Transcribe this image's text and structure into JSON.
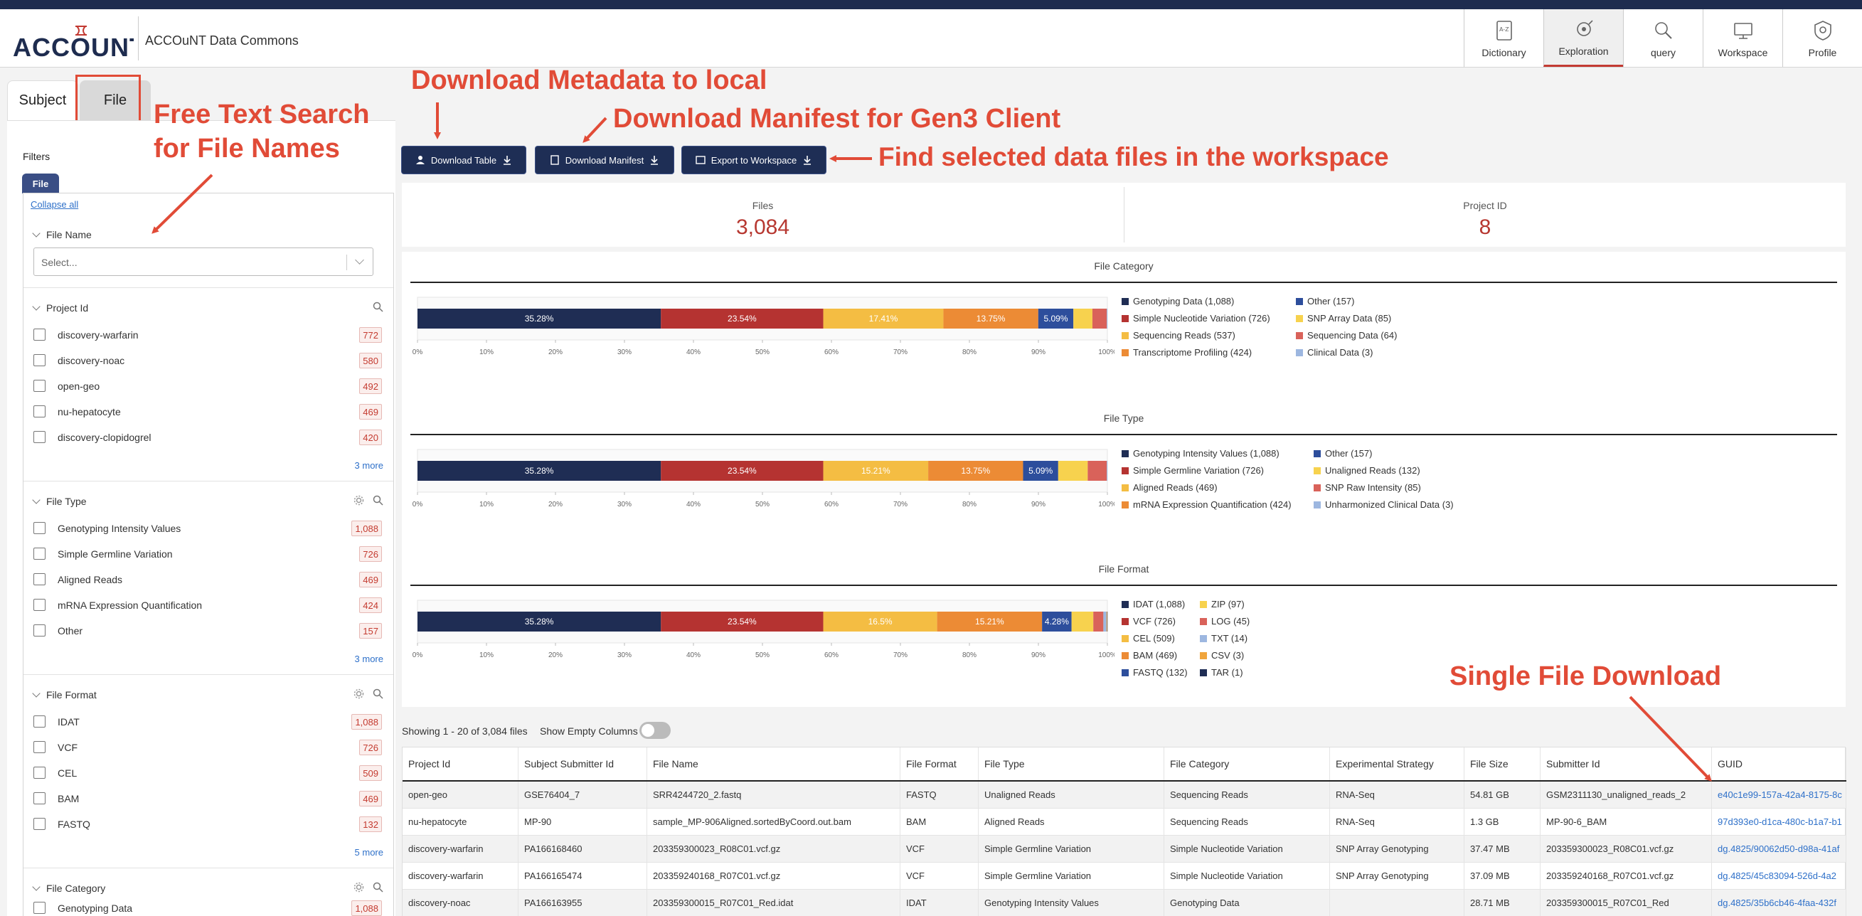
{
  "header": {
    "logo_text": "ACCOUNT",
    "commons_name": "ACCOuNT Data Commons",
    "nav": [
      {
        "label": "Dictionary",
        "icon": "dictionary-icon"
      },
      {
        "label": "Exploration",
        "icon": "exploration-icon",
        "active": true
      },
      {
        "label": "query",
        "icon": "query-icon"
      },
      {
        "label": "Workspace",
        "icon": "workspace-icon"
      },
      {
        "label": "Profile",
        "icon": "profile-icon"
      }
    ]
  },
  "tabs": {
    "subject": "Subject",
    "file": "File"
  },
  "filters": {
    "title": "Filters",
    "chip": "File",
    "collapse_all": "Collapse all",
    "file_name": {
      "title": "File Name",
      "placeholder": "Select..."
    },
    "project_id": {
      "title": "Project Id",
      "options": [
        {
          "label": "discovery-warfarin",
          "count": "772"
        },
        {
          "label": "discovery-noac",
          "count": "580"
        },
        {
          "label": "open-geo",
          "count": "492"
        },
        {
          "label": "nu-hepatocyte",
          "count": "469"
        },
        {
          "label": "discovery-clopidogrel",
          "count": "420"
        }
      ],
      "more": "3 more"
    },
    "file_type": {
      "title": "File Type",
      "options": [
        {
          "label": "Genotyping Intensity Values",
          "count": "1,088"
        },
        {
          "label": "Simple Germline Variation",
          "count": "726"
        },
        {
          "label": "Aligned Reads",
          "count": "469"
        },
        {
          "label": "mRNA Expression Quantification",
          "count": "424"
        },
        {
          "label": "Other",
          "count": "157"
        }
      ],
      "more": "3 more"
    },
    "file_format": {
      "title": "File Format",
      "options": [
        {
          "label": "IDAT",
          "count": "1,088"
        },
        {
          "label": "VCF",
          "count": "726"
        },
        {
          "label": "CEL",
          "count": "509"
        },
        {
          "label": "BAM",
          "count": "469"
        },
        {
          "label": "FASTQ",
          "count": "132"
        }
      ],
      "more": "5 more"
    },
    "file_category": {
      "title": "File Category",
      "options": [
        {
          "label": "Genotyping Data",
          "count": "1,088"
        }
      ]
    }
  },
  "buttons": {
    "download_table": "Download Table",
    "download_manifest": "Download Manifest",
    "export_workspace": "Export to Workspace"
  },
  "stats": {
    "files_label": "Files",
    "files_value": "3,084",
    "project_label": "Project ID",
    "project_value": "8"
  },
  "chart_data": [
    {
      "type": "bar",
      "orientation": "horizontal-stacked",
      "title": "File Category",
      "xlim": [
        0,
        100
      ],
      "ticks": [
        "0%",
        "10%",
        "20%",
        "30%",
        "40%",
        "50%",
        "60%",
        "70%",
        "80%",
        "90%",
        "100%"
      ],
      "series": [
        {
          "name": "Genotyping Data",
          "count": "1,088",
          "percent": 35.28,
          "label": "35.28%",
          "color": "#1f2d54"
        },
        {
          "name": "Simple Nucleotide Variation",
          "count": "726",
          "percent": 23.54,
          "label": "23.54%",
          "color": "#b53331"
        },
        {
          "name": "Sequencing Reads",
          "count": "537",
          "percent": 17.41,
          "label": "17.41%",
          "color": "#f4bd43"
        },
        {
          "name": "Transcriptome Profiling",
          "count": "424",
          "percent": 13.75,
          "label": "13.75%",
          "color": "#ec8b35"
        },
        {
          "name": "Other",
          "count": "157",
          "percent": 5.09,
          "label": "5.09%",
          "color": "#2d4e9c"
        },
        {
          "name": "SNP Array Data",
          "count": "85",
          "percent": 2.76,
          "label": "",
          "color": "#f7d24e"
        },
        {
          "name": "Sequencing Data",
          "count": "64",
          "percent": 2.08,
          "label": "",
          "color": "#d9625a"
        },
        {
          "name": "Clinical Data",
          "count": "3",
          "percent": 0.1,
          "label": "",
          "color": "#9db7e0"
        }
      ]
    },
    {
      "type": "bar",
      "orientation": "horizontal-stacked",
      "title": "File Type",
      "xlim": [
        0,
        100
      ],
      "ticks": [
        "0%",
        "10%",
        "20%",
        "30%",
        "40%",
        "50%",
        "60%",
        "70%",
        "80%",
        "90%",
        "100%"
      ],
      "series": [
        {
          "name": "Genotyping Intensity Values",
          "count": "1,088",
          "percent": 35.28,
          "label": "35.28%",
          "color": "#1f2d54"
        },
        {
          "name": "Simple Germline Variation",
          "count": "726",
          "percent": 23.54,
          "label": "23.54%",
          "color": "#b53331"
        },
        {
          "name": "Aligned Reads",
          "count": "469",
          "percent": 15.21,
          "label": "15.21%",
          "color": "#f4bd43"
        },
        {
          "name": "mRNA Expression Quantification",
          "count": "424",
          "percent": 13.75,
          "label": "13.75%",
          "color": "#ec8b35"
        },
        {
          "name": "Other",
          "count": "157",
          "percent": 5.09,
          "label": "5.09%",
          "color": "#2d4e9c"
        },
        {
          "name": "Unaligned Reads",
          "count": "132",
          "percent": 4.28,
          "label": "",
          "color": "#f7d24e"
        },
        {
          "name": "SNP Raw Intensity",
          "count": "85",
          "percent": 2.76,
          "label": "",
          "color": "#d9625a"
        },
        {
          "name": "Unharmonized Clinical Data",
          "count": "3",
          "percent": 0.1,
          "label": "",
          "color": "#9db7e0"
        }
      ]
    },
    {
      "type": "bar",
      "orientation": "horizontal-stacked",
      "title": "File Format",
      "xlim": [
        0,
        100
      ],
      "ticks": [
        "0%",
        "10%",
        "20%",
        "30%",
        "40%",
        "50%",
        "60%",
        "70%",
        "80%",
        "90%",
        "100%"
      ],
      "series": [
        {
          "name": "IDAT",
          "count": "1,088",
          "percent": 35.28,
          "label": "35.28%",
          "color": "#1f2d54"
        },
        {
          "name": "VCF",
          "count": "726",
          "percent": 23.54,
          "label": "23.54%",
          "color": "#b53331"
        },
        {
          "name": "CEL",
          "count": "509",
          "percent": 16.5,
          "label": "16.5%",
          "color": "#f4bd43"
        },
        {
          "name": "BAM",
          "count": "469",
          "percent": 15.21,
          "label": "15.21%",
          "color": "#ec8b35"
        },
        {
          "name": "FASTQ",
          "count": "132",
          "percent": 4.28,
          "label": "4.28%",
          "color": "#2d4e9c"
        },
        {
          "name": "ZIP",
          "count": "97",
          "percent": 3.15,
          "label": "",
          "color": "#f7d24e"
        },
        {
          "name": "LOG",
          "count": "45",
          "percent": 1.46,
          "label": "",
          "color": "#d9625a"
        },
        {
          "name": "TXT",
          "count": "14",
          "percent": 0.45,
          "label": "",
          "color": "#9db7e0"
        },
        {
          "name": "CSV",
          "count": "3",
          "percent": 0.1,
          "label": "",
          "color": "#f0a53c"
        },
        {
          "name": "TAR",
          "count": "1",
          "percent": 0.03,
          "label": "",
          "color": "#1f2d54"
        }
      ]
    }
  ],
  "table": {
    "showing": "Showing 1 - 20 of 3,084 files",
    "show_empty": "Show Empty Columns",
    "columns": [
      "Project Id",
      "Subject Submitter Id",
      "File Name",
      "File Format",
      "File Type",
      "File Category",
      "Experimental Strategy",
      "File Size",
      "Submitter Id",
      "GUID"
    ],
    "rows": [
      [
        "open-geo",
        "GSE76404_7",
        "SRR4244720_2.fastq",
        "FASTQ",
        "Unaligned Reads",
        "Sequencing Reads",
        "RNA-Seq",
        "54.81 GB",
        "GSM2311130_unaligned_reads_2",
        "e40c1e99-157a-42a4-8175-8c"
      ],
      [
        "nu-hepatocyte",
        "MP-90",
        "sample_MP-906Aligned.sortedByCoord.out.bam",
        "BAM",
        "Aligned Reads",
        "Sequencing Reads",
        "RNA-Seq",
        "1.3 GB",
        "MP-90-6_BAM",
        "97d393e0-d1ca-480c-b1a7-b1"
      ],
      [
        "discovery-warfarin",
        "PA166168460",
        "203359300023_R08C01.vcf.gz",
        "VCF",
        "Simple Germline Variation",
        "Simple Nucleotide Variation",
        "SNP Array Genotyping",
        "37.47 MB",
        "203359300023_R08C01.vcf.gz",
        "dg.4825/90062d50-d98a-41af"
      ],
      [
        "discovery-warfarin",
        "PA166165474",
        "203359240168_R07C01.vcf.gz",
        "VCF",
        "Simple Germline Variation",
        "Simple Nucleotide Variation",
        "SNP Array Genotyping",
        "37.09 MB",
        "203359240168_R07C01.vcf.gz",
        "dg.4825/45c83094-526d-4a2"
      ],
      [
        "discovery-noac",
        "PA166163955",
        "203359300015_R07C01_Red.idat",
        "IDAT",
        "Genotyping Intensity Values",
        "Genotyping Data",
        "",
        "28.71 MB",
        "203359300015_R07C01_Red",
        "dg.4825/35b6cb46-4faa-432f"
      ]
    ]
  },
  "annotations": {
    "download_metadata": "Download Metadata to local",
    "download_manifest": "Download Manifest for Gen3 Client",
    "free_text_1": "Free Text Search",
    "free_text_2": "for File Names",
    "find_workspace": "Find selected data files in the workspace",
    "single_download": "Single File Download"
  },
  "colors": {
    "accent": "#e14b37",
    "brand_navy": "#1e2c4f",
    "count_red": "#b73831",
    "link": "#2e70c9"
  }
}
